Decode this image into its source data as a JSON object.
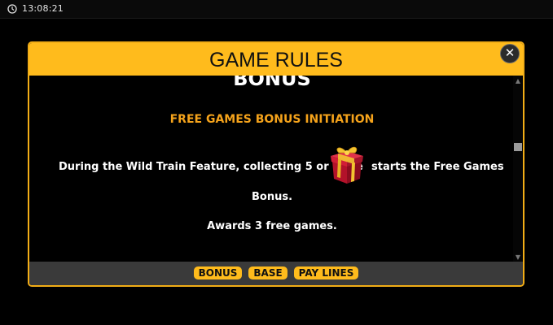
{
  "status_bar": {
    "clock_icon": "clock-icon",
    "time": "13:08:21"
  },
  "modal": {
    "title": "GAME RULES",
    "close_label": "✕",
    "section_title_partial": "BONUS",
    "subheading": "FREE GAMES BONUS INITIATION",
    "text_before_icon": "During the Wild Train Feature, collecting 5 or more",
    "inline_icon": "gift-box-icon",
    "text_after_icon": "starts the Free Games",
    "text_wrap": "Bonus.",
    "awards_text": "Awards 3 free games."
  },
  "nav": {
    "buttons": [
      {
        "label": "BONUS"
      },
      {
        "label": "BASE"
      },
      {
        "label": "PAY LINES"
      }
    ]
  },
  "colors": {
    "accent": "#ffbb1c",
    "subheading": "#f5a31b",
    "footer": "#3a3a3a"
  }
}
